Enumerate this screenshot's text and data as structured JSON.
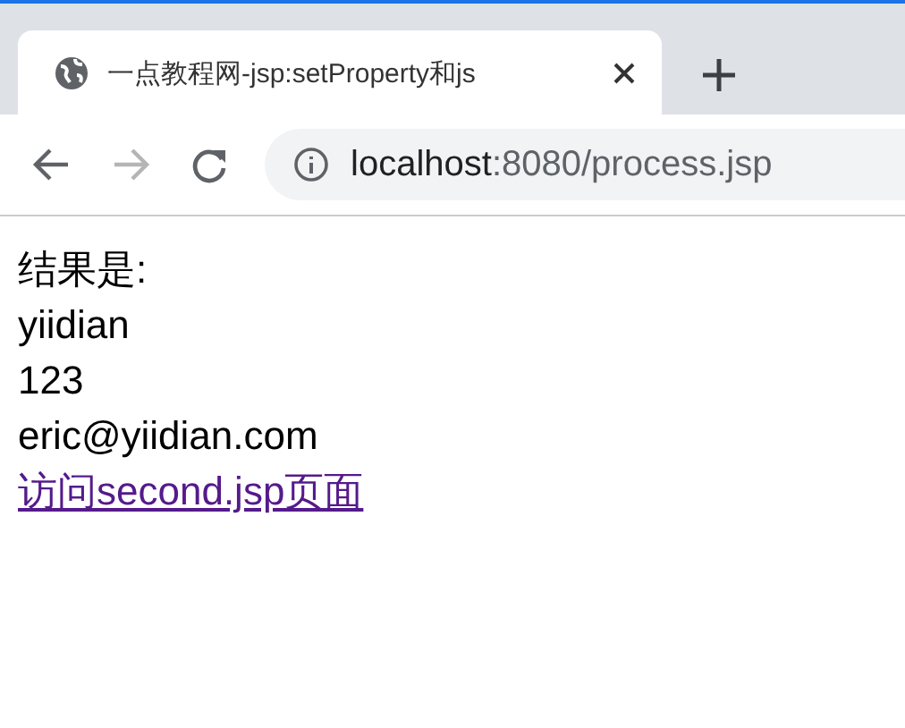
{
  "tab": {
    "title": "一点教程网-jsp:setProperty和js",
    "selected": true
  },
  "toolbar": {
    "back_disabled": false,
    "forward_disabled": true,
    "address_host": "localhost",
    "address_rest": ":8080/process.jsp"
  },
  "content": {
    "lines": [
      "结果是:",
      "yiidian",
      "123",
      "eric@yiidian.com"
    ],
    "link": "访问second.jsp页面"
  }
}
